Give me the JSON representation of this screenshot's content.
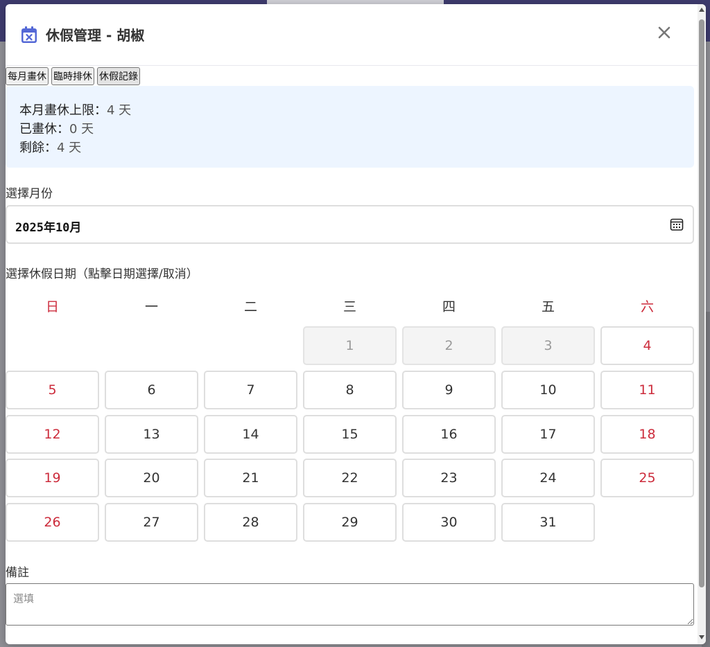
{
  "modal": {
    "title": "休假管理 - 胡椒",
    "title_icon": "calendar-x-icon",
    "close_icon": "close-icon",
    "accent_color": "#5468d6"
  },
  "tabs": [
    {
      "label": "每月畫休"
    },
    {
      "label": "臨時排休"
    },
    {
      "label": "休假記錄"
    }
  ],
  "quota": {
    "limit_key": "本月畫休上限：",
    "limit_value": "4 天",
    "used_key": "已畫休：",
    "used_value": "0 天",
    "remain_key": "剩餘：",
    "remain_value": "4 天"
  },
  "month": {
    "label": "選擇月份",
    "value": "2025年10月",
    "icon": "calendar-icon"
  },
  "calendar": {
    "label": "選擇休假日期（點擊日期選擇/取消）",
    "weekdays": [
      "日",
      "一",
      "二",
      "三",
      "四",
      "五",
      "六"
    ],
    "weekend_color": "#cc2b3b",
    "days": [
      "1",
      "2",
      "3",
      "4",
      "5",
      "6",
      "7",
      "8",
      "9",
      "10",
      "11",
      "12",
      "13",
      "14",
      "15",
      "16",
      "17",
      "18",
      "19",
      "20",
      "21",
      "22",
      "23",
      "24",
      "25",
      "26",
      "27",
      "28",
      "29",
      "30",
      "31"
    ],
    "disabled_days": [
      "1",
      "2",
      "3"
    ]
  },
  "note": {
    "label": "備註",
    "placeholder": "選填"
  }
}
